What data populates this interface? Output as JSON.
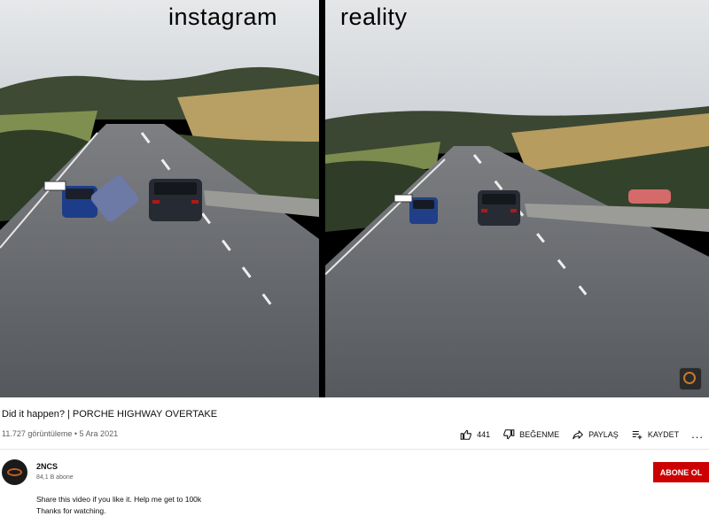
{
  "video": {
    "left_caption": "instagram",
    "right_caption": "reality"
  },
  "title": "Did it happen? | PORCHE HIGHWAY OVERTAKE",
  "meta": "11.727 görüntüleme • 5 Ara 2021",
  "actions": {
    "like_count": "441",
    "dislike_label": "BEĞENME",
    "share_label": "PAYLAŞ",
    "save_label": "KAYDET",
    "more_label": "..."
  },
  "channel": {
    "name": "2NCS",
    "subscribers": "84,1 B abone",
    "subscribe_label": "ABONE OL"
  },
  "description": {
    "line1": "Share this video if you like it. Help me get to 100k",
    "line2": "Thanks for watching."
  },
  "colors": {
    "subscribe": "#cc0000",
    "meta_text": "#606060"
  }
}
